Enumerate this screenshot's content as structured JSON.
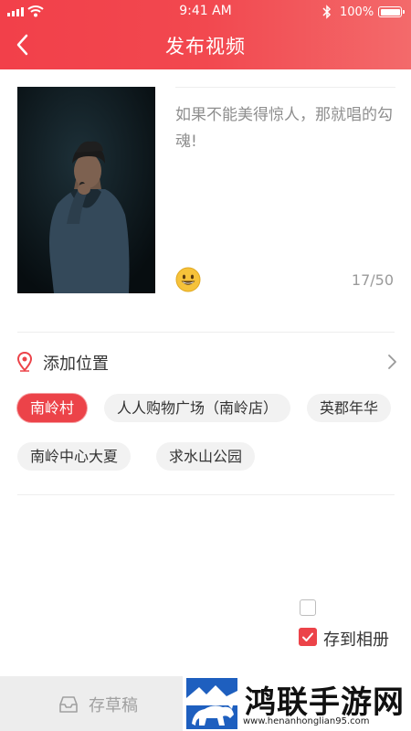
{
  "status_bar": {
    "time": "9:41 AM",
    "battery": "100%"
  },
  "header": {
    "title": "发布视频"
  },
  "post": {
    "caption_placeholder": "如果不能美得惊人，那就唱的勾魂!",
    "char_count": "17/50"
  },
  "location": {
    "label": "添加位置",
    "chips": [
      "南岭村",
      "人人购物广场（南岭店）",
      "英郡年华",
      "南岭中心大夏",
      "求水山公园"
    ],
    "selected_chip": "南岭村"
  },
  "options": {
    "save_to_album": "存到相册",
    "save_to_album_checked": true
  },
  "footer": {
    "draft_label": "存草稿",
    "brand_name": "鸿联手游网",
    "brand_domain": "www.henanhonglian95.com"
  },
  "colors": {
    "accent": "#ec4349",
    "header_start": "#f2404a",
    "header_end": "#f36a6b"
  },
  "icons": {
    "back": "chevron-left-icon",
    "location": "location-pin-icon",
    "emoji": "smiley-emoji-icon",
    "more": "chevron-right-icon",
    "draft": "draft-box-icon",
    "checkbox": "checkbox-icon"
  }
}
